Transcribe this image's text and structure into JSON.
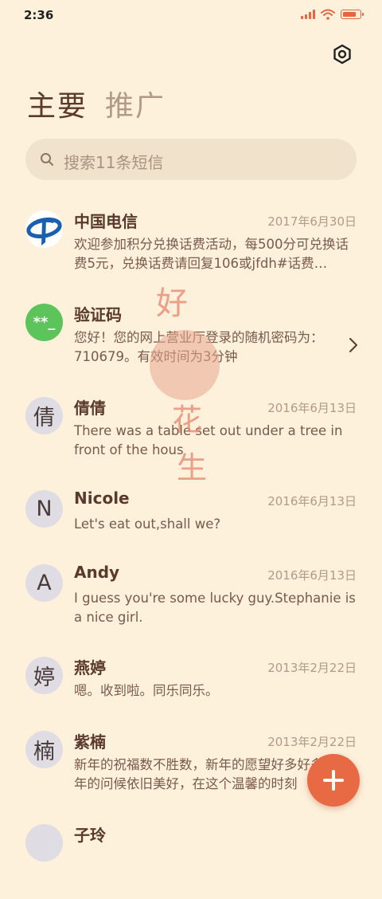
{
  "status": {
    "time": "2:36",
    "battery_level": 0.85
  },
  "tabs": [
    {
      "label": "主要",
      "active": true
    },
    {
      "label": "推广",
      "active": false
    }
  ],
  "search": {
    "placeholder": "搜索11条短信"
  },
  "messages": [
    {
      "name": "中国电信",
      "date": "2017年6月30日",
      "snippet": "欢迎参加积分兑换话费活动，每500分可兑换话费5元，兑换话费请回复106或jfdh#话费…",
      "avatar": "telecom-logo"
    },
    {
      "name": "验证码",
      "date": "",
      "snippet": "您好！您的网上营业厅登录的随机密码为：710679。有效时间为3分钟",
      "avatar": "**_"
    },
    {
      "name": "倩倩",
      "date": "2016年6月13日",
      "snippet": "There was a table set out under a tree in front of the hous",
      "avatar": "倩"
    },
    {
      "name": "Nicole",
      "date": "2016年6月13日",
      "snippet": "Let's eat out,shall we?",
      "avatar": "N"
    },
    {
      "name": "Andy",
      "date": "2016年6月13日",
      "snippet": "I guess you're some lucky guy.Stephanie is a nice girl.",
      "avatar": "A"
    },
    {
      "name": "燕婷",
      "date": "2013年2月22日",
      "snippet": "嗯。收到啦。同乐同乐。",
      "avatar": "婷"
    },
    {
      "name": "紫楠",
      "date": "2013年2月22日",
      "snippet": "新年的祝福数不胜数，新年的愿望好多好多，新年的问候依旧美好，在这个温馨的时刻",
      "avatar": "楠"
    },
    {
      "name": "子玲",
      "date": "",
      "snippet": "",
      "avatar": ""
    }
  ],
  "decoration": {
    "chars": [
      "好",
      "花",
      "生"
    ]
  },
  "colors": {
    "background": "#fdf1dc",
    "accent": "#e86a45",
    "search_bg": "#f1e3cb"
  }
}
